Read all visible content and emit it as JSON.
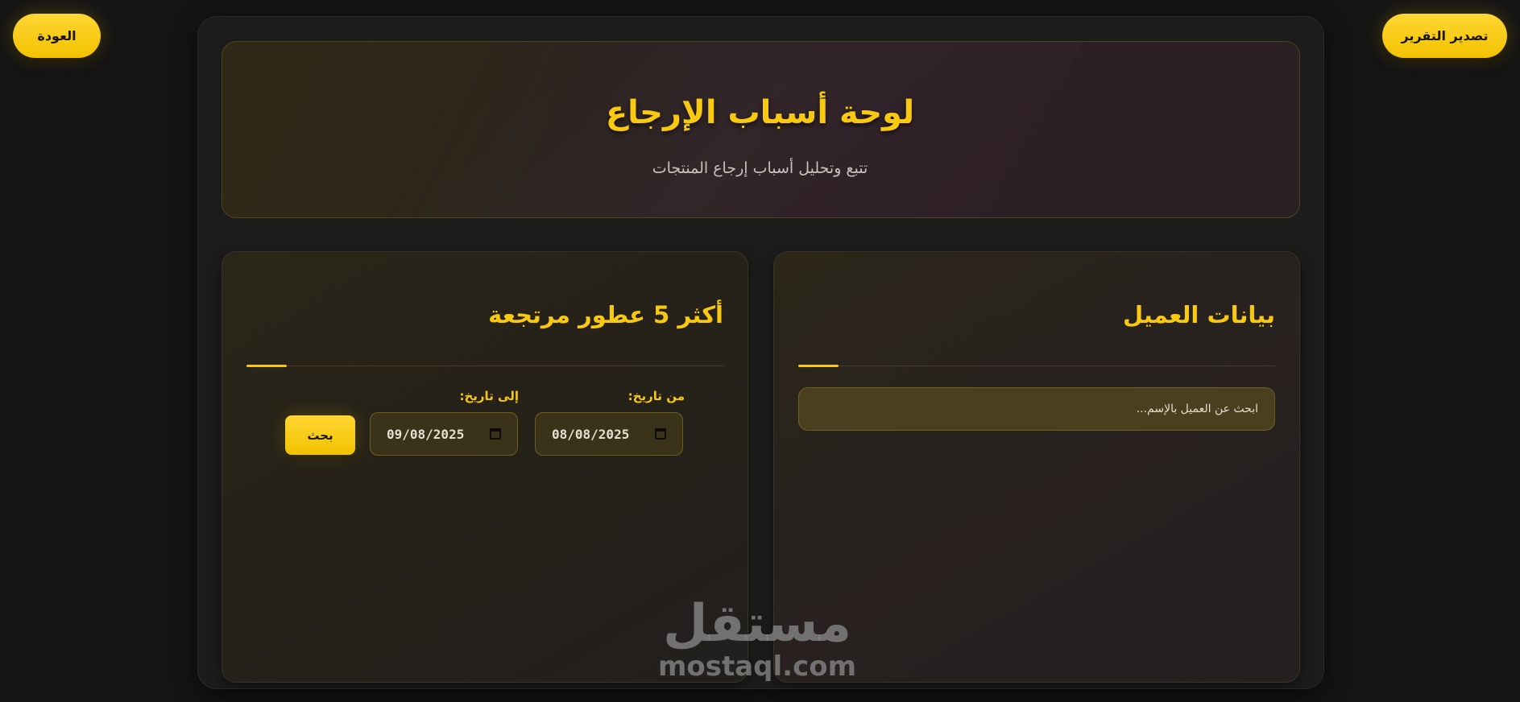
{
  "topbar": {
    "back_label": "العودة",
    "export_label": "تصدير التقرير"
  },
  "header": {
    "title": "لوحة أسباب الإرجاع",
    "subtitle": "تتبع وتحليل أسباب إرجاع المنتجات"
  },
  "customer_card": {
    "title": "بيانات العميل",
    "search_placeholder": "ابحث عن العميل بالإسم..."
  },
  "top5_card": {
    "title": "أكثر 5 عطور مرتجعة",
    "from_label": "من تاريخ:",
    "to_label": "إلى تاريخ:",
    "from_date": "08/08/2025",
    "to_date": "09/08/2025",
    "search_label": "بحث"
  },
  "watermark": {
    "arabic": "مستقل",
    "latin": "mostaql.com"
  },
  "colors": {
    "accent": "#f9c911",
    "background": "#151515"
  }
}
